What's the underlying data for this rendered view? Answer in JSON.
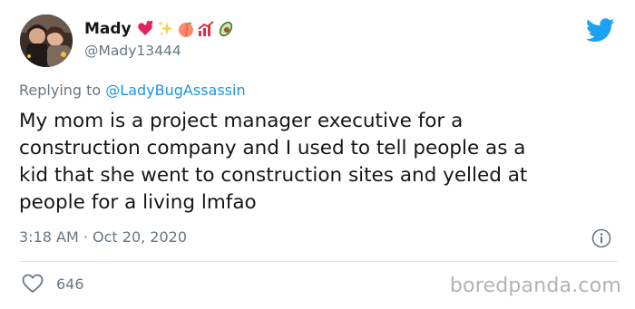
{
  "user": {
    "display_name": "Mady",
    "handle": "@Mady13444",
    "emojis": [
      "two-hearts-emoji",
      "sparkles-emoji",
      "peach-emoji",
      "chart-emoji",
      "avocado-emoji"
    ]
  },
  "reply": {
    "prefix": "Replying to ",
    "mention": "@LadyBugAssassin"
  },
  "tweet": {
    "text": "My mom is a project manager executive for a\nconstruction company  and I used to tell people as a\nkid that she went to construction sites and yelled at\npeople for a living lmfao",
    "timestamp": "3:18 AM · Oct 20, 2020"
  },
  "actions": {
    "likes": "646"
  },
  "watermark": "boredpanda.com",
  "colors": {
    "twitter_blue": "#1da1f2",
    "secondary_text": "#657786",
    "mention": "#1b95e0"
  }
}
